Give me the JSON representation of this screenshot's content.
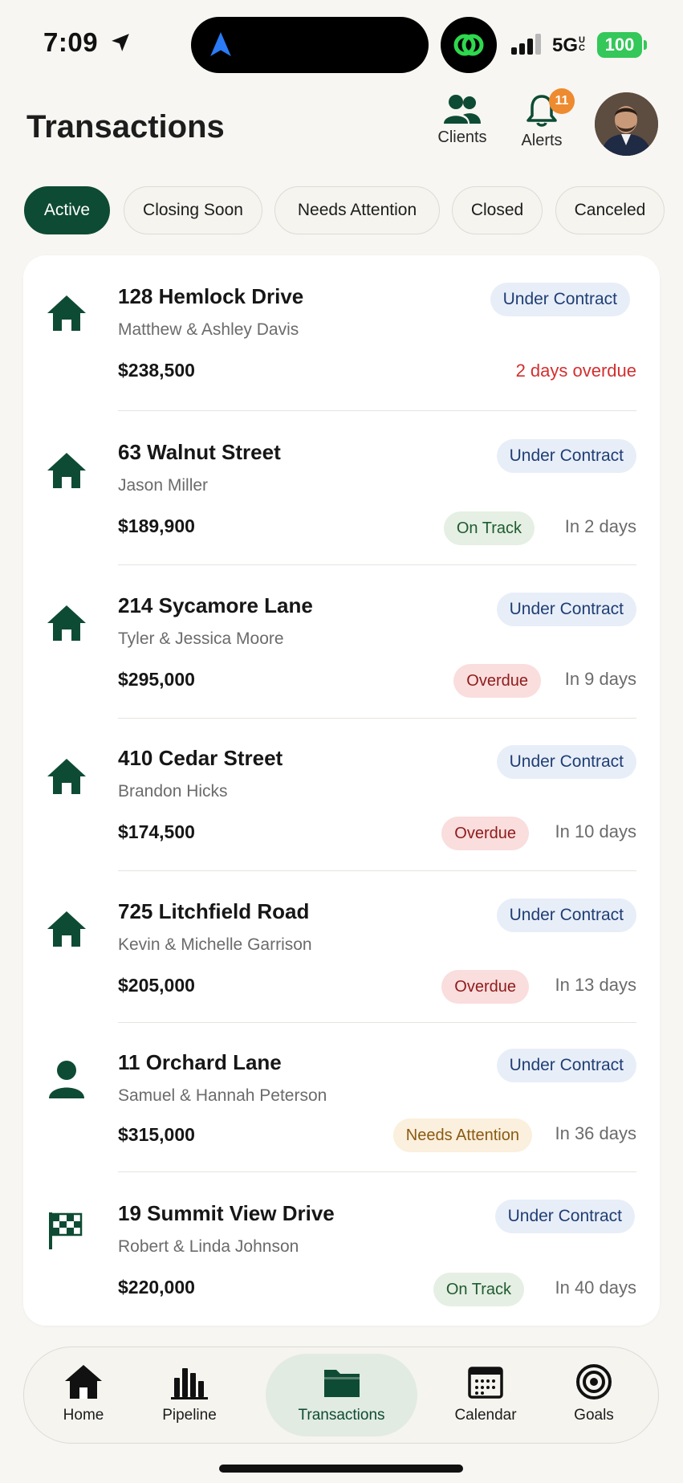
{
  "status_bar": {
    "time": "7:09",
    "network": "5G",
    "network_sup": "UC",
    "battery": "100"
  },
  "header": {
    "title": "Transactions",
    "clients_label": "Clients",
    "alerts_label": "Alerts",
    "alerts_count": "11"
  },
  "filters": [
    "Active",
    "Closing Soon",
    "Needs Attention",
    "Closed",
    "Canceled"
  ],
  "transactions": [
    {
      "icon": "house-icon",
      "address": "128 Hemlock Drive",
      "client": "Matthew & Ashley Davis",
      "price": "$238,500",
      "stage": "Under Contract",
      "status": "",
      "due": "2 days overdue"
    },
    {
      "icon": "house-icon",
      "address": "63 Walnut Street",
      "client": "Jason Miller",
      "price": "$189,900",
      "stage": "Under Contract",
      "status": "On Track",
      "due": "In 2 days"
    },
    {
      "icon": "house-icon",
      "address": "214 Sycamore Lane",
      "client": "Tyler & Jessica Moore",
      "price": "$295,000",
      "stage": "Under Contract",
      "status": "Overdue",
      "due": "In 9 days"
    },
    {
      "icon": "house-icon",
      "address": "410 Cedar Street",
      "client": "Brandon Hicks",
      "price": "$174,500",
      "stage": "Under Contract",
      "status": "Overdue",
      "due": "In 10 days"
    },
    {
      "icon": "house-icon",
      "address": "725 Litchfield Road",
      "client": "Kevin & Michelle Garrison",
      "price": "$205,000",
      "stage": "Under Contract",
      "status": "Overdue",
      "due": "In 13 days"
    },
    {
      "icon": "person-icon",
      "address": "11 Orchard Lane",
      "client": "Samuel & Hannah Peterson",
      "price": "$315,000",
      "stage": "Under Contract",
      "status": "Needs Attention",
      "due": "In 36 days"
    },
    {
      "icon": "checkered-flag-icon",
      "address": "19 Summit View Drive",
      "client": "Robert & Linda Johnson",
      "price": "$220,000",
      "stage": "Under Contract",
      "status": "On Track",
      "due": "In 40 days"
    }
  ],
  "tabs": [
    "Home",
    "Pipeline",
    "Transactions",
    "Calendar",
    "Goals"
  ],
  "colors": {
    "brand": "#0e4b34",
    "overdue_text": "#d32f2f",
    "badge": "#ee8a2f"
  }
}
